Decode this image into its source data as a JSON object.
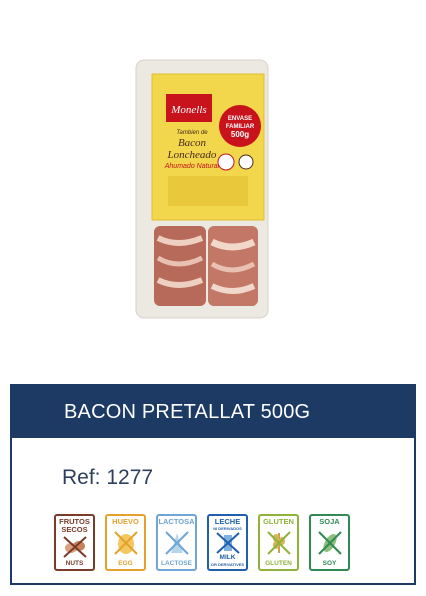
{
  "product": {
    "title": "BACON PRETALLAT 500G",
    "ref_label": "Ref:",
    "ref_value": "1277",
    "package": {
      "brand": "Monells",
      "line1": "Tambien de",
      "line2": "Bacon",
      "line3": "Loncheado",
      "line4": "Ahumado Natural",
      "badge_line1": "ENVASE",
      "badge_line2": "FAMILIAR",
      "badge_line3": "500g"
    }
  },
  "allergens": [
    {
      "top": "FRUTOS SECOS",
      "bottom": "NUTS",
      "color": "#7a3b2a",
      "icon": "nuts-icon"
    },
    {
      "top": "HUEVO",
      "bottom": "EGG",
      "color": "#e5a12b",
      "icon": "egg-icon"
    },
    {
      "top": "LACTOSA",
      "bottom": "LACTOSE",
      "color": "#6ea6d6",
      "icon": "lactose-icon"
    },
    {
      "top": "LECHE",
      "top2": "NI DERIVADOS",
      "bottom": "MILK",
      "bottom2": "OR DERIVATIVES",
      "color": "#1f5fae",
      "icon": "milk-icon"
    },
    {
      "top": "GLUTEN",
      "bottom": "GLUTEN",
      "color": "#8fb33a",
      "icon": "gluten-icon"
    },
    {
      "top": "SOJA",
      "bottom": "SOY",
      "color": "#2f8a54",
      "icon": "soy-icon"
    }
  ],
  "colors": {
    "header_bg": "#1c3a64",
    "header_text": "#ffffff",
    "ref_text": "#2d3f5c"
  }
}
